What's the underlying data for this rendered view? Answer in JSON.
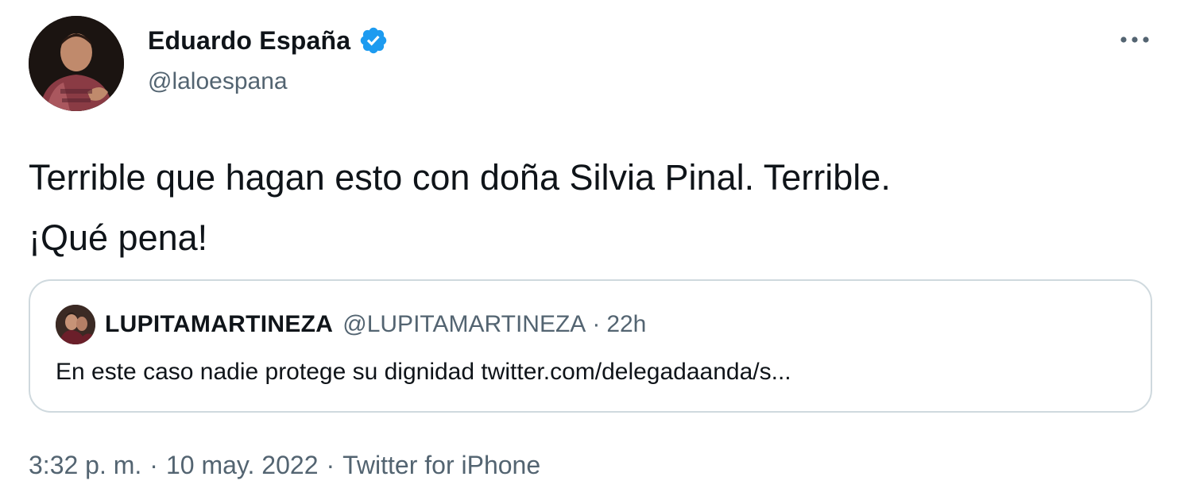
{
  "author": {
    "name": "Eduardo España",
    "handle": "@laloespana",
    "verified": true,
    "avatar_icon": "profile-photo-icon"
  },
  "tweet": {
    "text_line1": "Terrible que hagan esto con doña Silvia Pinal. Terrible.",
    "text_line2": "¡Qué pena!"
  },
  "quote": {
    "name": "LUPITAMARTINEZA",
    "handle": "@LUPITAMARTINEZA",
    "dot": "·",
    "time": "22h",
    "text": "En este caso nadie protege su dignidad twitter.com/delegadaanda/s..."
  },
  "meta": {
    "time": "3:32 p. m.",
    "sep1": "·",
    "date": "10 may. 2022",
    "sep2": "·",
    "source": "Twitter for iPhone"
  },
  "colors": {
    "text_primary": "#0f1419",
    "text_secondary": "#536471",
    "verified_blue": "#1d9bf0",
    "border": "#cfd9de"
  }
}
